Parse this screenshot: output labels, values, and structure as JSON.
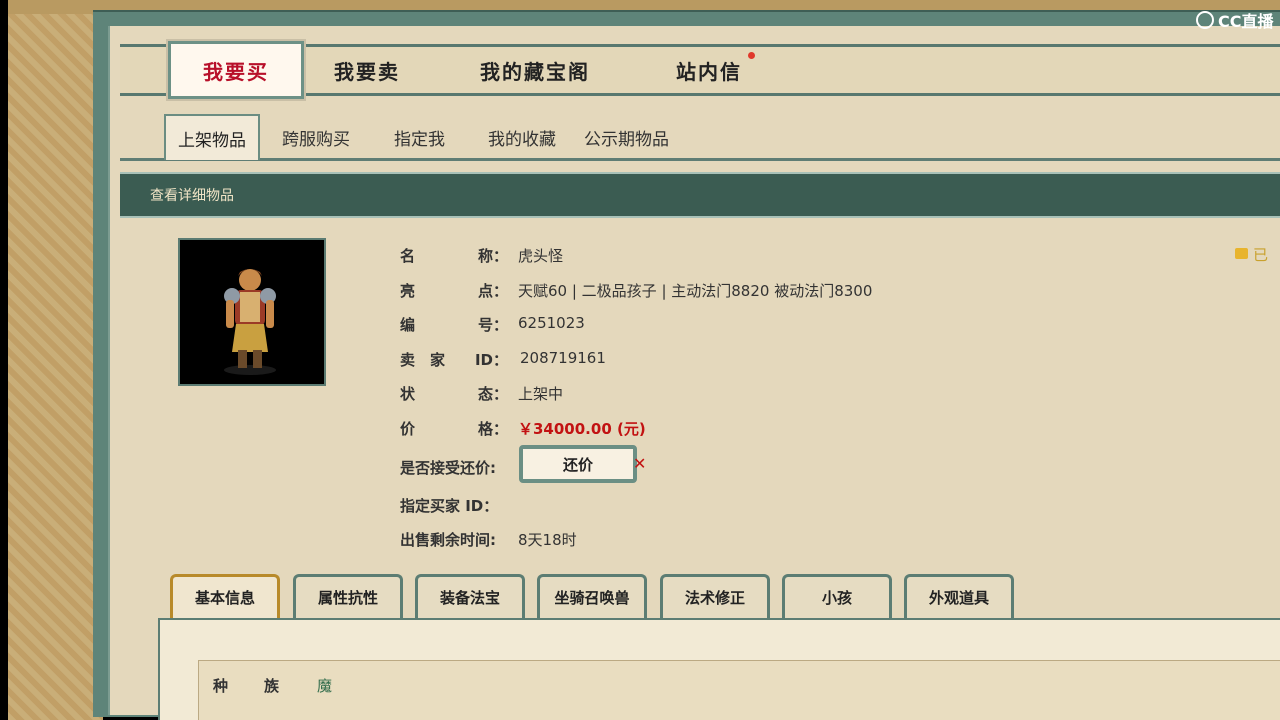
{
  "watermark": {
    "text": "CC直播",
    "icon": "cc-logo-icon"
  },
  "topnav": {
    "tabs": [
      {
        "label": "我要买",
        "active": true
      },
      {
        "label": "我要卖"
      },
      {
        "label": "我的藏宝阁"
      },
      {
        "label": "站内信",
        "has_notification": true
      }
    ]
  },
  "subnav": {
    "tabs": [
      {
        "label": "上架物品",
        "active": true
      },
      {
        "label": "跨服购买"
      },
      {
        "label": "指定我"
      },
      {
        "label": "我的收藏"
      },
      {
        "label": "公示期物品"
      }
    ]
  },
  "section": {
    "title": "查看详细物品"
  },
  "item": {
    "name_label": [
      "名",
      "称："
    ],
    "name": "虎头怪",
    "highlight_label": [
      "亮",
      "点："
    ],
    "highlight": "天赋60 | 二极品孩子 | 主动法门8820 被动法门8300",
    "id_label": [
      "编",
      "号："
    ],
    "id": "6251023",
    "seller_label": [
      "卖　家",
      "ID："
    ],
    "seller_id": "208719161",
    "status_label": [
      "状",
      "态："
    ],
    "status": "上架中",
    "price_label": [
      "价",
      "格："
    ],
    "price": "￥34000.00 (元)",
    "counter_label": "是否接受还价:",
    "counter_button": "还价",
    "counter_mark": "✕",
    "buyer_label": "指定买家 ID：",
    "remaining_label": "出售剩余时间:",
    "remaining": "8天18时",
    "fav_text": "已"
  },
  "bottom_tabs": [
    {
      "label": "基本信息",
      "active": true
    },
    {
      "label": "属性抗性"
    },
    {
      "label": "装备法宝"
    },
    {
      "label": "坐骑召唤兽"
    },
    {
      "label": "法术修正"
    },
    {
      "label": "小孩"
    },
    {
      "label": "外观道具"
    }
  ],
  "detail": {
    "race_label": [
      "种",
      "族"
    ],
    "race": "魔"
  },
  "colors": {
    "accent_red": "#c21212",
    "panel_green": "#3b5c52",
    "parchment": "#e4d8bc"
  }
}
